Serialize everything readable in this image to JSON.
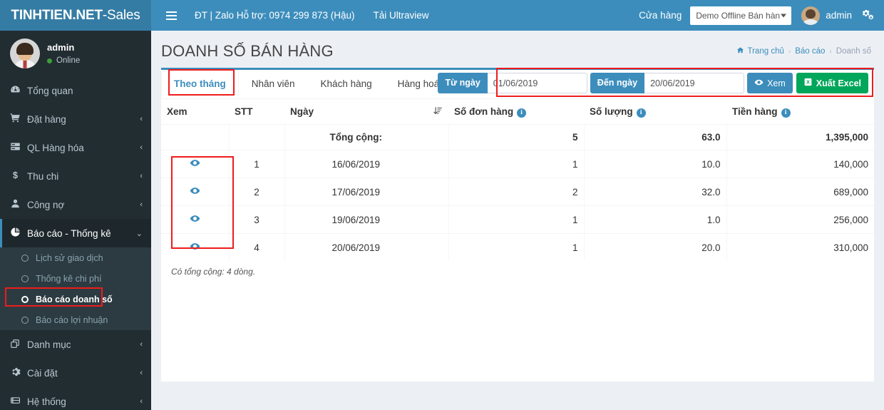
{
  "brand": {
    "bold": "TINHTIEN.NET",
    "light": "-Sales"
  },
  "navbar": {
    "hamburger": "menu-icon",
    "support_link": "ĐT | Zalo Hỗ trợ: 0974 299 873 (Hậu)",
    "ultraview_link": "Tải Ultraview",
    "store_label": "Cửa hàng",
    "store_selected": "Demo Offline Bán hàn",
    "user_name": "admin",
    "gear": "gear-icon"
  },
  "sidebar": {
    "user": {
      "name": "admin",
      "status": "Online"
    },
    "items": [
      {
        "label": "Tổng quan",
        "icon": "dashboard-icon",
        "arrow": "",
        "active": false
      },
      {
        "label": "Đặt hàng",
        "icon": "cart-icon",
        "arrow": "‹",
        "active": false
      },
      {
        "label": "QL Hàng hóa",
        "icon": "boxes-icon",
        "arrow": "‹",
        "active": false
      },
      {
        "label": "Thu chi",
        "icon": "dollar-icon",
        "arrow": "‹",
        "active": false
      },
      {
        "label": "Công nợ",
        "icon": "user-icon",
        "arrow": "‹",
        "active": false
      },
      {
        "label": "Báo cáo - Thống kê",
        "icon": "pie-chart-icon",
        "arrow": "⌄",
        "active": true
      }
    ],
    "submenu": [
      {
        "label": "Lịch sử giao dịch",
        "active": false
      },
      {
        "label": "Thống kê chi phí",
        "active": false
      },
      {
        "label": "Báo cáo doanh số",
        "active": true
      },
      {
        "label": "Báo cáo lợi nhuận",
        "active": false
      }
    ],
    "items_after": [
      {
        "label": "Danh mục",
        "icon": "copy-icon",
        "arrow": "‹"
      },
      {
        "label": "Cài đặt",
        "icon": "cog-icon",
        "arrow": "‹"
      },
      {
        "label": "Hệ thống",
        "icon": "server-icon",
        "arrow": "‹"
      }
    ]
  },
  "page": {
    "title": "DOANH SỐ BÁN HÀNG",
    "breadcrumb": {
      "home_icon": "home-icon",
      "home": "Trang chủ",
      "level2": "Báo cáo",
      "level3": "Doanh số",
      "separator": "›"
    }
  },
  "tabs": [
    {
      "label": "Theo tháng",
      "active": true
    },
    {
      "label": "Nhân viên",
      "active": false
    },
    {
      "label": "Khách hàng",
      "active": false
    },
    {
      "label": "Hàng hoá",
      "active": false
    }
  ],
  "filter": {
    "from_label": "Từ ngày",
    "from_value": "01/06/2019",
    "to_label": "Đến ngày",
    "to_value": "20/06/2019",
    "view_button": "Xem",
    "view_icon": "eye-icon",
    "export_button": "Xuất Excel",
    "export_icon": "excel-icon"
  },
  "table": {
    "headers": {
      "xem": "Xem",
      "stt": "STT",
      "ngay": "Ngày",
      "sort_icon": "sort-amount-desc-icon",
      "so_don_hang": "Số đơn hàng",
      "so_luong": "Số lượng",
      "tien_hang": "Tiền hàng",
      "info_icon": "info-icon"
    },
    "total_row": {
      "label": "Tổng cộng:",
      "so_don_hang": "5",
      "so_luong": "63.0",
      "tien_hang": "1,395,000"
    },
    "rows": [
      {
        "eye": "eye-icon",
        "stt": "1",
        "ngay": "16/06/2019",
        "so_don_hang": "1",
        "so_luong": "10.0",
        "tien_hang": "140,000"
      },
      {
        "eye": "eye-icon",
        "stt": "2",
        "ngay": "17/06/2019",
        "so_don_hang": "2",
        "so_luong": "32.0",
        "tien_hang": "689,000"
      },
      {
        "eye": "eye-icon",
        "stt": "3",
        "ngay": "19/06/2019",
        "so_don_hang": "1",
        "so_luong": "1.0",
        "tien_hang": "256,000"
      },
      {
        "eye": "eye-icon",
        "stt": "4",
        "ngay": "20/06/2019",
        "so_don_hang": "1",
        "so_luong": "20.0",
        "tien_hang": "310,000"
      }
    ],
    "footer": "Có tổng cộng: 4 dòng."
  },
  "colors": {
    "header_blue": "#3c8dbc",
    "logo_blue": "#357ca5",
    "sidebar_dark": "#222d32",
    "submenu_dark": "#2c3b41",
    "green": "#00a65a",
    "highlight_red": "#ee1c1c",
    "body_bg": "#ecf0f5"
  }
}
